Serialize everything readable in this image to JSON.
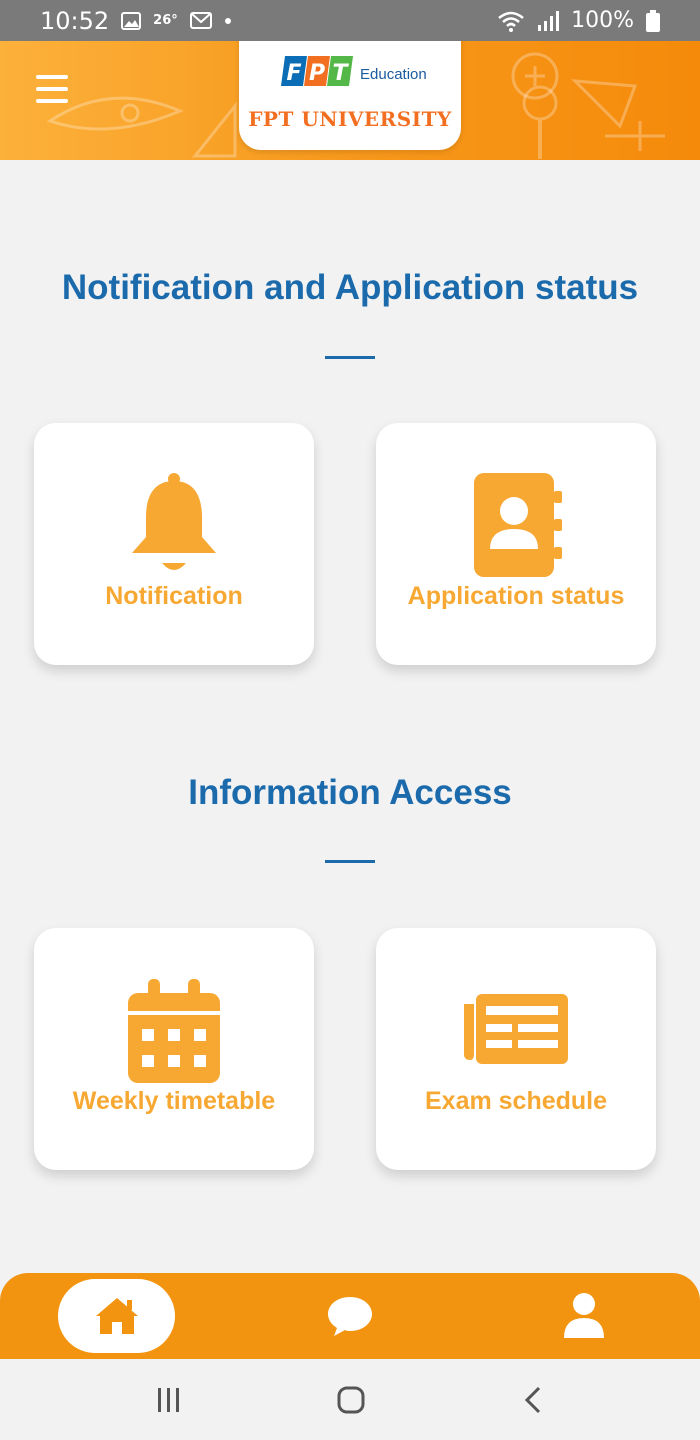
{
  "status_bar": {
    "time": "10:52",
    "temperature": "26°",
    "battery": "100%",
    "icons": [
      "image-icon",
      "gmail-icon",
      "dot-icon",
      "wifi-icon",
      "signal-icon",
      "battery-icon"
    ]
  },
  "header": {
    "logo_letters": "FPT",
    "logo_subtitle": "Education",
    "university_name": "FPT UNIVERSITY",
    "menu_icon": "hamburger-menu-icon"
  },
  "sections": [
    {
      "title": "Notification and Application status",
      "cards": [
        {
          "label": "Notification",
          "icon": "bell-icon"
        },
        {
          "label": "Application status",
          "icon": "contact-book-icon"
        }
      ]
    },
    {
      "title": "Information Access",
      "cards": [
        {
          "label": "Weekly timetable",
          "icon": "calendar-icon"
        },
        {
          "label": "Exam schedule",
          "icon": "newspaper-icon"
        }
      ]
    }
  ],
  "bottom_nav": {
    "items": [
      {
        "icon": "home-icon",
        "active": true
      },
      {
        "icon": "chat-icon",
        "active": false
      },
      {
        "icon": "user-icon",
        "active": false
      }
    ]
  },
  "system_nav": [
    "recent-apps-icon",
    "home-circle-icon",
    "back-icon"
  ],
  "colors": {
    "accent_orange": "#f39410",
    "card_label_orange": "#f7a833",
    "title_blue": "#1b6aac",
    "background": "#f2f2f2"
  }
}
